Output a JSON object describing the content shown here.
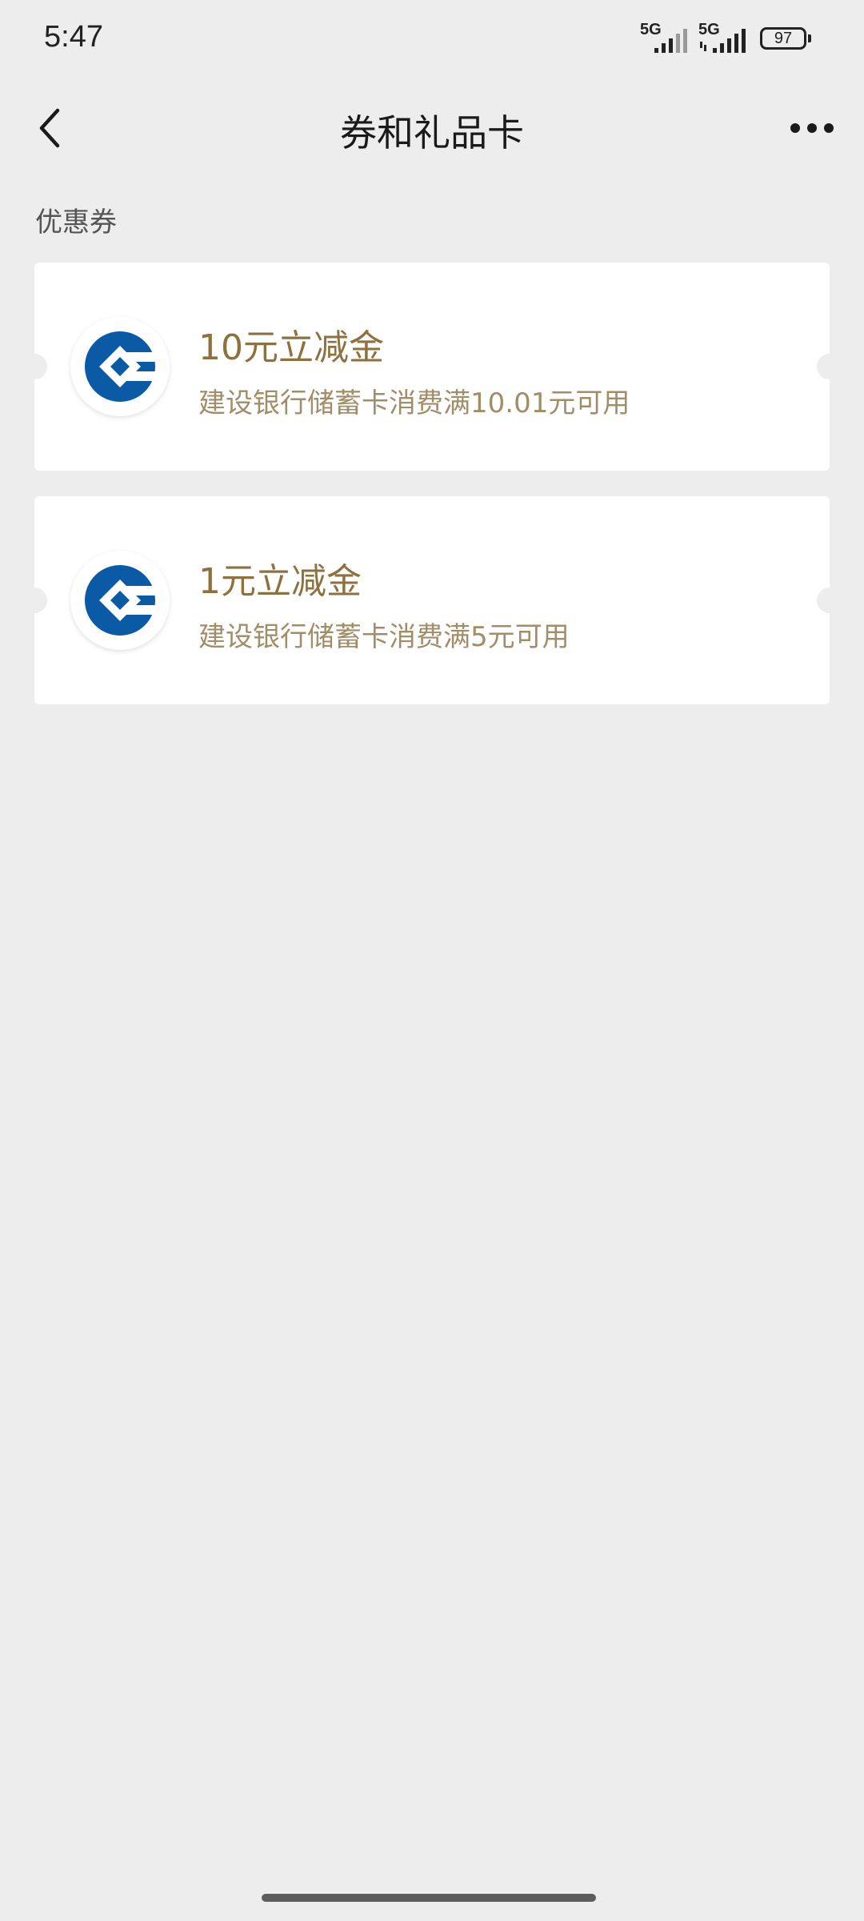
{
  "status_bar": {
    "time": "5:47",
    "sim1_network": "5G",
    "sim2_network": "5G",
    "battery_level": "97"
  },
  "header": {
    "title": "券和礼品卡",
    "back_icon": "chevron-left-icon",
    "more_icon": "more-horizontal-icon"
  },
  "section": {
    "label": "优惠券"
  },
  "coupons": [
    {
      "title": "10元立减金",
      "description": "建设银行储蓄卡消费满10.01元可用",
      "logo_icon": "ccb-bank-logo-icon"
    },
    {
      "title": "1元立减金",
      "description": "建设银行储蓄卡消费满5元可用",
      "logo_icon": "ccb-bank-logo-icon"
    }
  ],
  "colors": {
    "background": "#ededed",
    "card": "#ffffff",
    "coupon_title": "#8d7240",
    "coupon_desc": "#a18d67",
    "bank_blue": "#0a5aa5"
  }
}
